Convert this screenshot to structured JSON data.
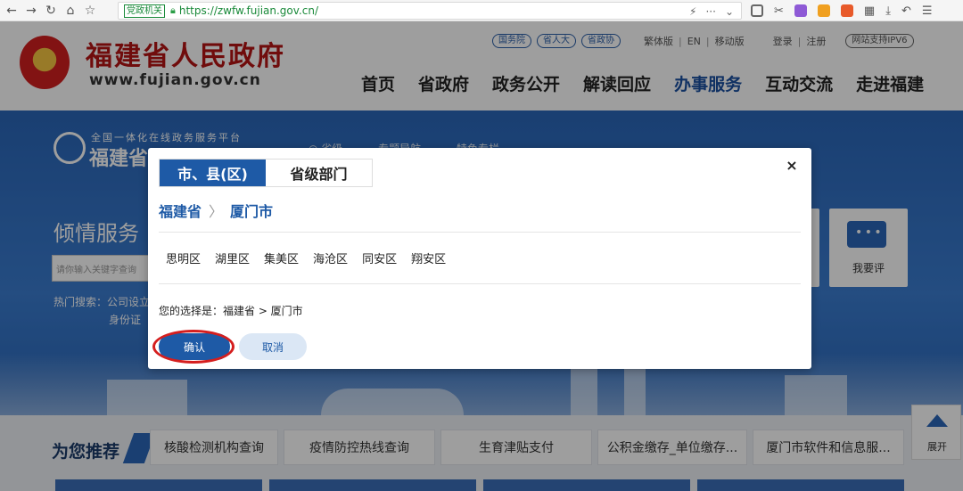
{
  "browser": {
    "gov_tag": "党政机关",
    "url": "https://zwfw.fujian.gov.cn/",
    "url_menu": "···",
    "nav_icons": [
      "arrow-left-icon",
      "arrow-right-icon",
      "reload-icon",
      "home-icon",
      "bookmark-icon"
    ],
    "toolbar_icons": [
      "lightning-icon",
      "dropdown-icon",
      "screenshot-icon",
      "scissors-icon",
      "extension-icon",
      "shield-icon",
      "game-icon",
      "grid-icon",
      "download-icon",
      "undo-icon",
      "menu-icon"
    ]
  },
  "header": {
    "site_title": "福建省人民政府",
    "site_url": "www.fujian.gov.cn",
    "pills": [
      "国务院",
      "省人大",
      "省政协"
    ],
    "links": [
      "繁体版",
      "EN",
      "移动版",
      "登录",
      "注册"
    ],
    "ipv6": "网站支持IPV6",
    "nav": [
      "首页",
      "省政府",
      "政务公开",
      "解读回应",
      "办事服务",
      "互动交流",
      "走进福建"
    ],
    "active_nav": "办事服务"
  },
  "banner": {
    "platform_line1": "全国一体化在线政务服务平台",
    "platform_line2": "福建省",
    "nav": [
      "◎ 省级 ⌄",
      "专题导航 ⌄",
      "特色专栏 ⌄"
    ],
    "service_title": "倾情服务 ·",
    "search_placeholder": "请你输入关键字查询",
    "hot_search": "热门搜索：公司设立",
    "hot_search2": "身份证",
    "comment_label": "我要评"
  },
  "recommend": {
    "title": "为您推荐",
    "new_tag": "NEW",
    "items": [
      "核酸检测机构查询",
      "疫情防控热线查询",
      "生育津贴支付",
      "公积金缴存_单位缴存...",
      "厦门市软件和信息服..."
    ],
    "expand_label": "展开"
  },
  "modal": {
    "tab_city": "市、县(区)",
    "tab_dept": "省级部门",
    "close": "×",
    "crumb_province": "福建省",
    "crumb_sep": "〉",
    "crumb_city": "厦门市",
    "districts": [
      "思明区",
      "湖里区",
      "集美区",
      "海沧区",
      "同安区",
      "翔安区"
    ],
    "selection": "您的选择是：福建省 > 厦门市",
    "confirm": "确认",
    "cancel": "取消"
  },
  "colors": {
    "primary": "#1e5aa6",
    "title_red": "#b51414",
    "highlight_ring": "#d51e1e"
  }
}
